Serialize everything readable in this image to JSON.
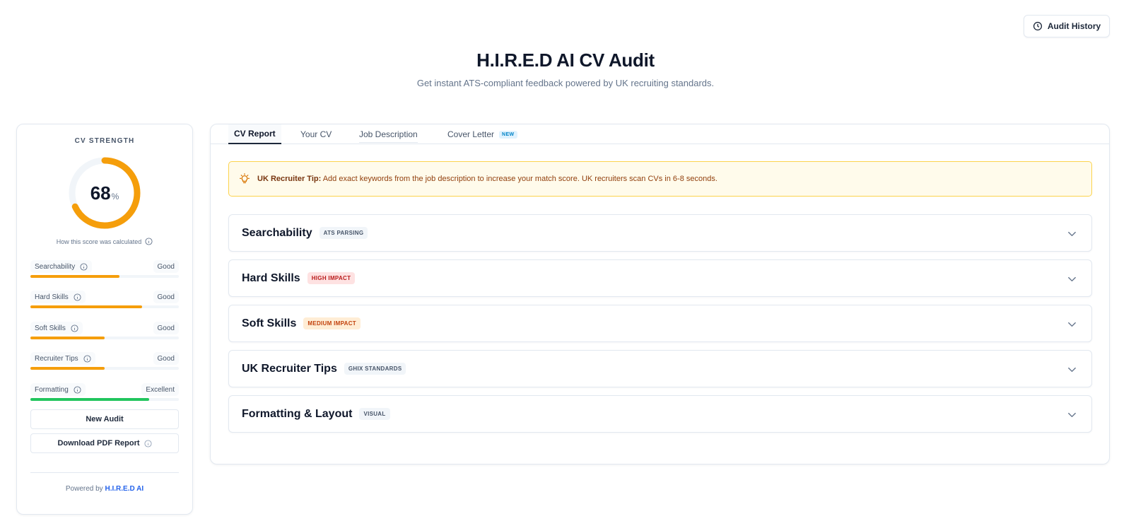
{
  "header": {
    "audit_history_label": "Audit History",
    "title": "H.I.R.E.D AI CV Audit",
    "subtitle": "Get instant ATS-compliant feedback powered by UK recruiting standards."
  },
  "score_card": {
    "label": "CV STRENGTH",
    "score": "68",
    "score_fraction": 0.68,
    "unit": "%",
    "ring_color": "#f59e0b",
    "calc_text": "How this score was calculated",
    "metrics": [
      {
        "name": "Searchability",
        "rating": "Good",
        "level": 0.6,
        "color": "#f59e0b"
      },
      {
        "name": "Hard Skills",
        "rating": "Good",
        "level": 0.75,
        "color": "#f59e0b"
      },
      {
        "name": "Soft Skills",
        "rating": "Good",
        "level": 0.5,
        "color": "#f59e0b"
      },
      {
        "name": "Recruiter Tips",
        "rating": "Good",
        "level": 0.5,
        "color": "#f59e0b"
      },
      {
        "name": "Formatting",
        "rating": "Excellent",
        "level": 0.8,
        "color": "#22c55e"
      }
    ],
    "new_audit_label": "New Audit",
    "download_label": "Download PDF Report",
    "powered_prefix": "Powered by",
    "powered_brand": "H.I.R.E.D AI"
  },
  "report": {
    "tabs": [
      {
        "label": "CV Report"
      },
      {
        "label": "Your CV"
      },
      {
        "label": "Job Description"
      },
      {
        "label": "Cover Letter",
        "badge": "NEW"
      }
    ],
    "tip": {
      "label": "UK Recruiter Tip:",
      "text": "Add exact keywords from the job description to increase your match score. UK recruiters scan CVs in 6-8 seconds."
    },
    "sections": [
      {
        "title": "Searchability",
        "tag": "ATS PARSING",
        "tag_bg": "#f1f5f9",
        "tag_fg": "#475569"
      },
      {
        "title": "Hard Skills",
        "tag": "HIGH IMPACT",
        "tag_bg": "#fee2e2",
        "tag_fg": "#b91c1c"
      },
      {
        "title": "Soft Skills",
        "tag": "MEDIUM IMPACT",
        "tag_bg": "#ffedd5",
        "tag_fg": "#c2410c"
      },
      {
        "title": "UK Recruiter Tips",
        "tag": "GHIX STANDARDS",
        "tag_bg": "#f1f5f9",
        "tag_fg": "#475569"
      },
      {
        "title": "Formatting & Layout",
        "tag": "VISUAL",
        "tag_bg": "#f1f5f9",
        "tag_fg": "#475569"
      }
    ]
  }
}
